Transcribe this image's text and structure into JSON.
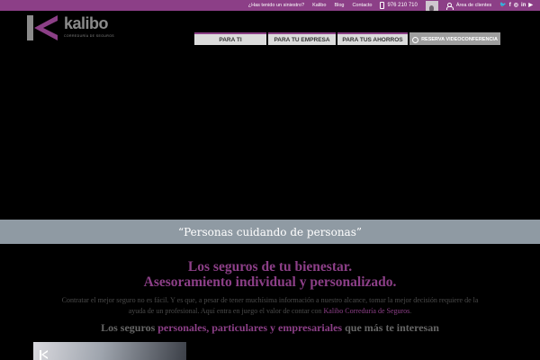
{
  "topbar": {
    "siniestro": "¿Has tenido un siniestro?",
    "kalibo": "Kalibo",
    "blog": "Blog",
    "contacto": "Contacto",
    "phone": "976 210 710",
    "area_clientes": "Área de clientes",
    "social_twitter": "🐦",
    "social_facebook": "f",
    "social_instagram": "◎",
    "social_linkedin": "in",
    "social_youtube": "▶"
  },
  "logo": {
    "name": "kalibo",
    "subtitle": "CORREDURÍA DE SEGUROS"
  },
  "nav": {
    "para_ti": "PARA TI",
    "empresa": "PARA TU EMPRESA",
    "ahorros": "PARA TUS AHORROS",
    "video": "RESERVA VIDEOCONFERENCIA"
  },
  "quote": "“Personas cuidando de personas”",
  "headline": {
    "line1": "Los seguros de tu bienestar.",
    "line2": "Asesoramiento individual y personalizado."
  },
  "body": {
    "text": "Contratar el mejor seguro no es fácil. Y es que, a pesar de tener muchísima información a nuestro alcance, tomar la mejor decisión requiere de la ayuda de un profesional. Aquí entra en juego el valor de contar con ",
    "brand_link": "Kalibo Correduría de Seguros",
    "end": "."
  },
  "subheadline": {
    "pre": "Los seguros ",
    "accent": "personales, particulares y empresariales",
    "post": " que más te interesan"
  },
  "colors": {
    "brand_purple": "#8c3f87",
    "quote_band": "#8f9aa3",
    "nav_bg": "#dcdcdc"
  }
}
